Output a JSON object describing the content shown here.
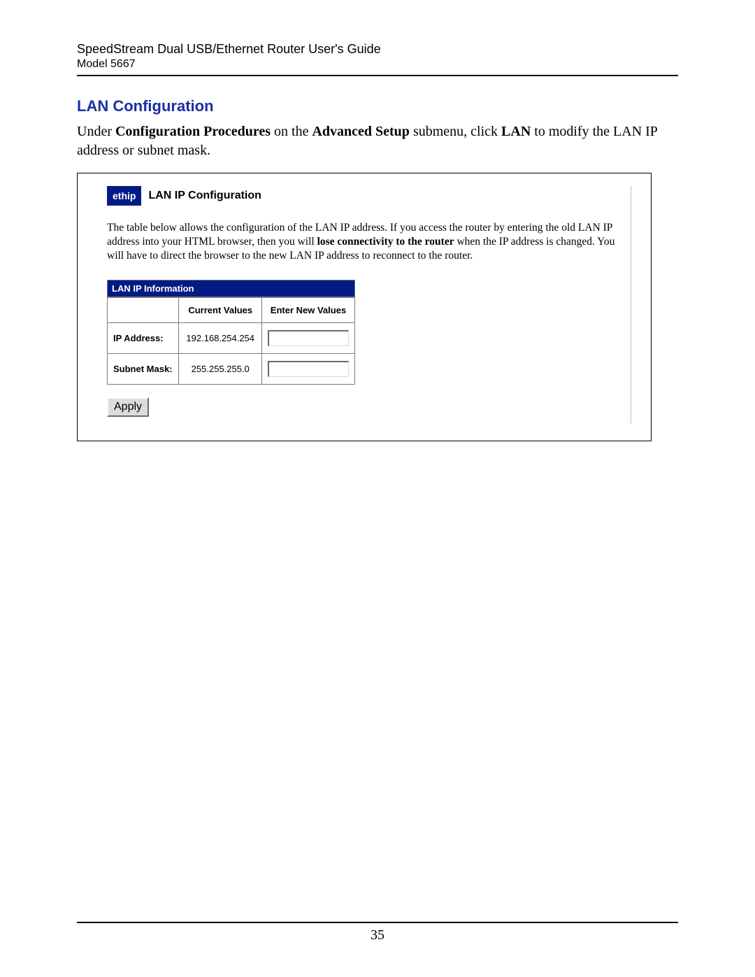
{
  "header": {
    "title": "SpeedStream Dual USB/Ethernet Router User's Guide",
    "model": "Model 5667"
  },
  "section": {
    "title": "LAN Configuration",
    "intro_pre": "Under ",
    "intro_b1": "Configuration Procedures",
    "intro_mid1": " on the ",
    "intro_b2": "Advanced Setup",
    "intro_mid2": " submenu, click ",
    "intro_b3": "LAN",
    "intro_post": " to modify the LAN IP address or subnet mask."
  },
  "figure": {
    "badge": "ethip",
    "title": "LAN IP Configuration",
    "desc_pre": "The table below allows the configuration of the LAN IP address. If you access the router by entering the old LAN IP address into your HTML browser, then you will ",
    "desc_bold": "lose connectivity to the router",
    "desc_post": " when the IP address is changed. You will have to direct the browser to the new LAN IP address to reconnect to the router.",
    "table": {
      "caption": "LAN IP Information",
      "col_current": "Current Values",
      "col_new": "Enter New Values",
      "rows": [
        {
          "label": "IP Address:",
          "value": "192.168.254.254",
          "input": ""
        },
        {
          "label": "Subnet Mask:",
          "value": "255.255.255.0",
          "input": ""
        }
      ]
    },
    "apply": "Apply"
  },
  "footer": {
    "page": "35"
  }
}
